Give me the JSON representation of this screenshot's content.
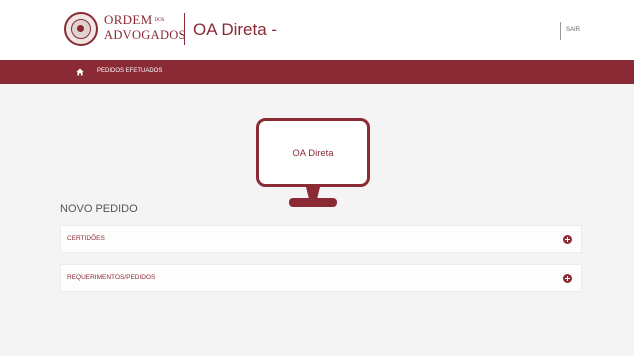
{
  "header": {
    "logo_line1": "ORDEM",
    "logo_line1_small": "DOS",
    "logo_line2": "ADVOGADOS",
    "app_title": "OA Direta -",
    "logout_label": "SAIR"
  },
  "navbar": {
    "home_icon": "home-icon",
    "link_label": "PEDIDOS EFETUADOS"
  },
  "monitor": {
    "screen_label": "OA Direta"
  },
  "main": {
    "section_title": "NOVO PEDIDO",
    "accordion": [
      {
        "label": "CERTIDÕES",
        "icon": "plus-circle-icon"
      },
      {
        "label": "REQUERIMENTOS/PEDIDOS",
        "icon": "plus-circle-icon"
      }
    ]
  },
  "colors": {
    "brand": "#8a2a35",
    "background": "#f4f4f4",
    "header_bg": "#ffffff"
  }
}
